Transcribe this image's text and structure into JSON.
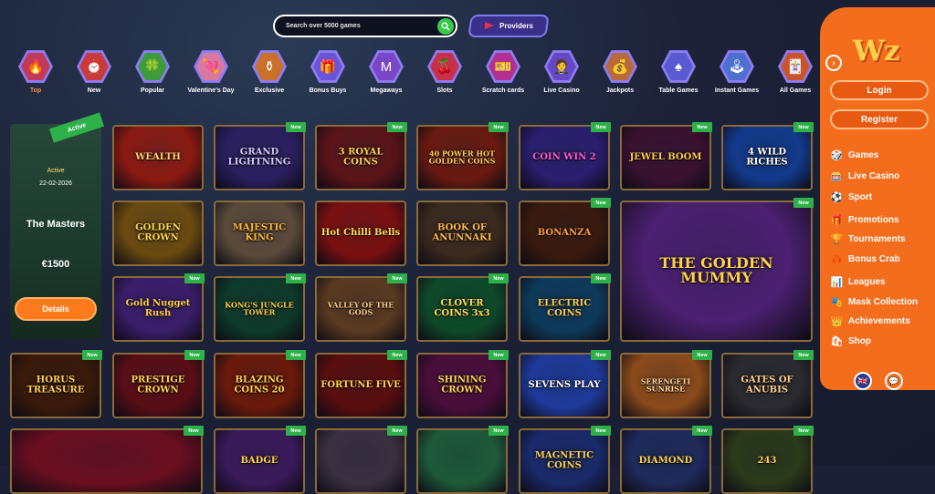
{
  "search": {
    "placeholder": "Search over 5000 games"
  },
  "providers": {
    "label": "Providers"
  },
  "categories": [
    {
      "label": "Top",
      "icon": "flame-icon",
      "glyph": "🔥",
      "color": "#c2395a"
    },
    {
      "label": "New",
      "icon": "alarm-clock-icon",
      "glyph": "⏰",
      "color": "#c83b3b"
    },
    {
      "label": "Popular",
      "icon": "clover-icon",
      "glyph": "🍀",
      "color": "#3c9b3c"
    },
    {
      "label": "Valentine's Day",
      "icon": "cupid-icon",
      "glyph": "💘",
      "color": "#d87aa0"
    },
    {
      "label": "Exclusive",
      "icon": "cauldron-icon",
      "glyph": "⚱",
      "color": "#c9702a"
    },
    {
      "label": "Bonus Buys",
      "icon": "gift-icon",
      "glyph": "🎁",
      "color": "#6a55d8"
    },
    {
      "label": "Megaways",
      "icon": "megaways-icon",
      "glyph": "M",
      "color": "#7b45c8"
    },
    {
      "label": "Slots",
      "icon": "cherries-icon",
      "glyph": "🍒",
      "color": "#c8304a"
    },
    {
      "label": "Scratch cards",
      "icon": "scratch-card-icon",
      "glyph": "🎫",
      "color": "#b13090"
    },
    {
      "label": "Live Casino",
      "icon": "dealer-icon",
      "glyph": "🤵",
      "color": "#6448c8"
    },
    {
      "label": "Jackpots",
      "icon": "money-bag-icon",
      "glyph": "💰",
      "color": "#b86a3a"
    },
    {
      "label": "Table Games",
      "icon": "spade-card-icon",
      "glyph": "♠",
      "color": "#5a5ad0"
    },
    {
      "label": "Instant Games",
      "icon": "joystick-icon",
      "glyph": "🕹",
      "color": "#4f6fd0"
    },
    {
      "label": "All Games",
      "icon": "all-games-icon",
      "glyph": "🃏",
      "color": "#c8552a"
    }
  ],
  "promo": {
    "ribbon": "Active",
    "status": "Active",
    "date": "22-02-2026",
    "title": "The Masters",
    "amount": "€1500",
    "button": "Details"
  },
  "new_badge": "New",
  "games": [
    {
      "title": "WEALTH",
      "new": false,
      "bg": "#8a1a12",
      "fg": "#ffd36a"
    },
    {
      "title": "GRAND LIGHTNING",
      "new": true,
      "bg": "#2a1f5e",
      "fg": "#d7c9ff"
    },
    {
      "title": "3 ROYAL COINS",
      "new": true,
      "bg": "#5a1418",
      "fg": "#ffcf4a"
    },
    {
      "title": "40 POWER HOT GOLDEN COINS",
      "new": true,
      "bg": "#6a1a10",
      "fg": "#ffd45a"
    },
    {
      "title": "COIN WIN 2",
      "new": true,
      "bg": "#2a1e6e",
      "fg": "#ff5ad0"
    },
    {
      "title": "JEWEL BOOM",
      "new": true,
      "bg": "#3a1230",
      "fg": "#ffcc4d"
    },
    {
      "title": "4 WILD RICHES",
      "new": true,
      "bg": "#123a8a",
      "fg": "#ffffff"
    },
    {
      "title": "GOLDEN CROWN",
      "new": false,
      "bg": "#6a4a10",
      "fg": "#ffd44a"
    },
    {
      "title": "MAJESTIC KING",
      "new": false,
      "bg": "#5a4a3a",
      "fg": "#ffb733"
    },
    {
      "title": "Hot Chilli Bells",
      "new": false,
      "bg": "#7a1010",
      "fg": "#ffe04a"
    },
    {
      "title": "BOOK OF ANUNNAKI",
      "new": false,
      "bg": "#3a2a1e",
      "fg": "#ffb74a"
    },
    {
      "title": "BONANZA",
      "new": true,
      "bg": "#3a1a0e",
      "fg": "#ff9a3a"
    },
    {
      "title": "THE GOLDEN MUMMY",
      "new": true,
      "bg": "#4a2070",
      "fg": "#ffd24a"
    },
    {
      "title": "Gold Nugget Rush",
      "new": true,
      "bg": "#3a1e6a",
      "fg": "#ffd04a"
    },
    {
      "title": "KONG'S JUNGLE TOWER",
      "new": true,
      "bg": "#0e3a2a",
      "fg": "#ffd24a"
    },
    {
      "title": "VALLEY OF THE GODS",
      "new": true,
      "bg": "#5a3a20",
      "fg": "#ffd08a"
    },
    {
      "title": "CLOVER COINS 3x3",
      "new": true,
      "bg": "#0e4a2a",
      "fg": "#ffe04a"
    },
    {
      "title": "ELECTRIC COINS",
      "new": true,
      "bg": "#0e3a5a",
      "fg": "#ffcf4a"
    },
    {
      "title": "HORUS TREASURE",
      "new": true,
      "bg": "#3a1a0a",
      "fg": "#ffcf4a"
    },
    {
      "title": "PRESTIGE CROWN",
      "new": true,
      "bg": "#5a0e16",
      "fg": "#ffd24a"
    },
    {
      "title": "BLAZING COINS 20",
      "new": true,
      "bg": "#6a1a0a",
      "fg": "#ffd04a"
    },
    {
      "title": "FORTUNE FIVE",
      "new": true,
      "bg": "#5a0e0e",
      "fg": "#ffd24a"
    },
    {
      "title": "SHINING CROWN",
      "new": true,
      "bg": "#4a0e3a",
      "fg": "#ffd24a"
    },
    {
      "title": "SEVENS PLAY",
      "new": true,
      "bg": "#1e3a9a",
      "fg": "#ffffff"
    },
    {
      "title": "SERENGETI SUNRISE",
      "new": true,
      "bg": "#8a4a1a",
      "fg": "#ffd8a0"
    },
    {
      "title": "GATES OF ANUBIS",
      "new": true,
      "bg": "#2a2a30",
      "fg": "#ffcf8a"
    },
    {
      "title": "",
      "new": true,
      "bg": "#6a0e20",
      "fg": "#ffd24a"
    },
    {
      "title": "BADGE",
      "new": true,
      "bg": "#3a1a5a",
      "fg": "#ffd24a"
    },
    {
      "title": "",
      "new": true,
      "bg": "#3a3040",
      "fg": "#ffffff"
    },
    {
      "title": "",
      "new": true,
      "bg": "#1e5a3a",
      "fg": "#ffffff"
    },
    {
      "title": "MAGNETIC COINS",
      "new": true,
      "bg": "#1a2a6a",
      "fg": "#ffd24a"
    },
    {
      "title": "DIAMOND",
      "new": true,
      "bg": "#1e2a5a",
      "fg": "#ffd24a"
    },
    {
      "title": "243",
      "new": true,
      "bg": "#2a3a1a",
      "fg": "#ffd24a"
    }
  ],
  "sidebar": {
    "login": "Login",
    "register": "Register",
    "nav": [
      {
        "label": "Games",
        "icon": "dice-icon",
        "glyph": "🎲"
      },
      {
        "label": "Live Casino",
        "icon": "roulette-icon",
        "glyph": "🎰"
      },
      {
        "label": "Sport",
        "icon": "soccer-ball-icon",
        "glyph": "⚽"
      },
      {
        "label": "Promotions",
        "icon": "gift-icon",
        "glyph": "🎁"
      },
      {
        "label": "Tournaments",
        "icon": "trophy-icon",
        "glyph": "🏆"
      },
      {
        "label": "Bonus Crab",
        "icon": "crab-claw-icon",
        "glyph": "🦀"
      },
      {
        "label": "Leagues",
        "icon": "league-icon",
        "glyph": "📊"
      },
      {
        "label": "Mask Collection",
        "icon": "mask-icon",
        "glyph": "🎭"
      },
      {
        "label": "Achievements",
        "icon": "crown-icon",
        "glyph": "👑"
      },
      {
        "label": "Shop",
        "icon": "shop-icon",
        "glyph": "🛍"
      }
    ]
  },
  "colors": {
    "accent": "#f46d1c",
    "new_badge": "#2fb14a",
    "search_btn": "#36c94a"
  }
}
